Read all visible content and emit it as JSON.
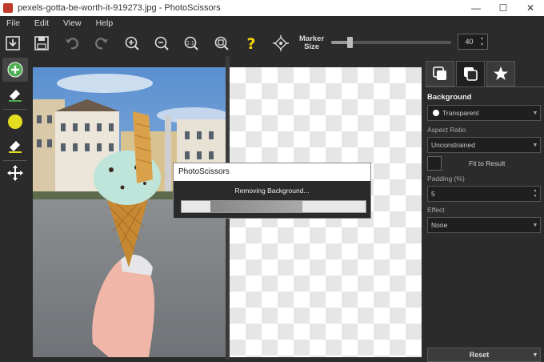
{
  "window": {
    "title": "pexels-gotta-be-worth-it-919273.jpg - PhotoScissors",
    "minimize": "—",
    "maximize": "☐",
    "close": "✕"
  },
  "menu": [
    "File",
    "Edit",
    "View",
    "Help"
  ],
  "toolbar": {
    "icons": [
      "open-icon",
      "save-icon",
      "undo-icon",
      "redo-icon",
      "zoom-in-icon",
      "zoom-out-icon",
      "actual-size-icon",
      "fit-icon",
      "help-icon",
      "fullscreen-icon"
    ],
    "marker_label_1": "Marker",
    "marker_label_2": "Size",
    "marker_size": "40",
    "marker_fraction": 0.15
  },
  "left_tools": [
    "add-foreground-icon",
    "foreground-eraser-icon",
    "add-background-icon",
    "background-eraser-icon",
    "move-icon"
  ],
  "dialog": {
    "title": "PhotoScissors",
    "message": "Removing Background..."
  },
  "right_panel": {
    "tabs": [
      "tab-foreground-icon",
      "tab-background-icon",
      "tab-effects-icon"
    ],
    "background_heading": "Background",
    "background_value": "Transparent",
    "aspect_label": "Aspect Ratio",
    "aspect_value": "Unconstrained",
    "fit_label": "Fit to Result",
    "padding_label": "Padding (%)",
    "padding_value": "5",
    "effect_label": "Effect",
    "effect_value": "None",
    "reset_label": "Reset"
  },
  "colors": {
    "accent_green": "#4caf50",
    "accent_yellow": "#e5dd1f",
    "help_yellow": "#f5d700"
  }
}
